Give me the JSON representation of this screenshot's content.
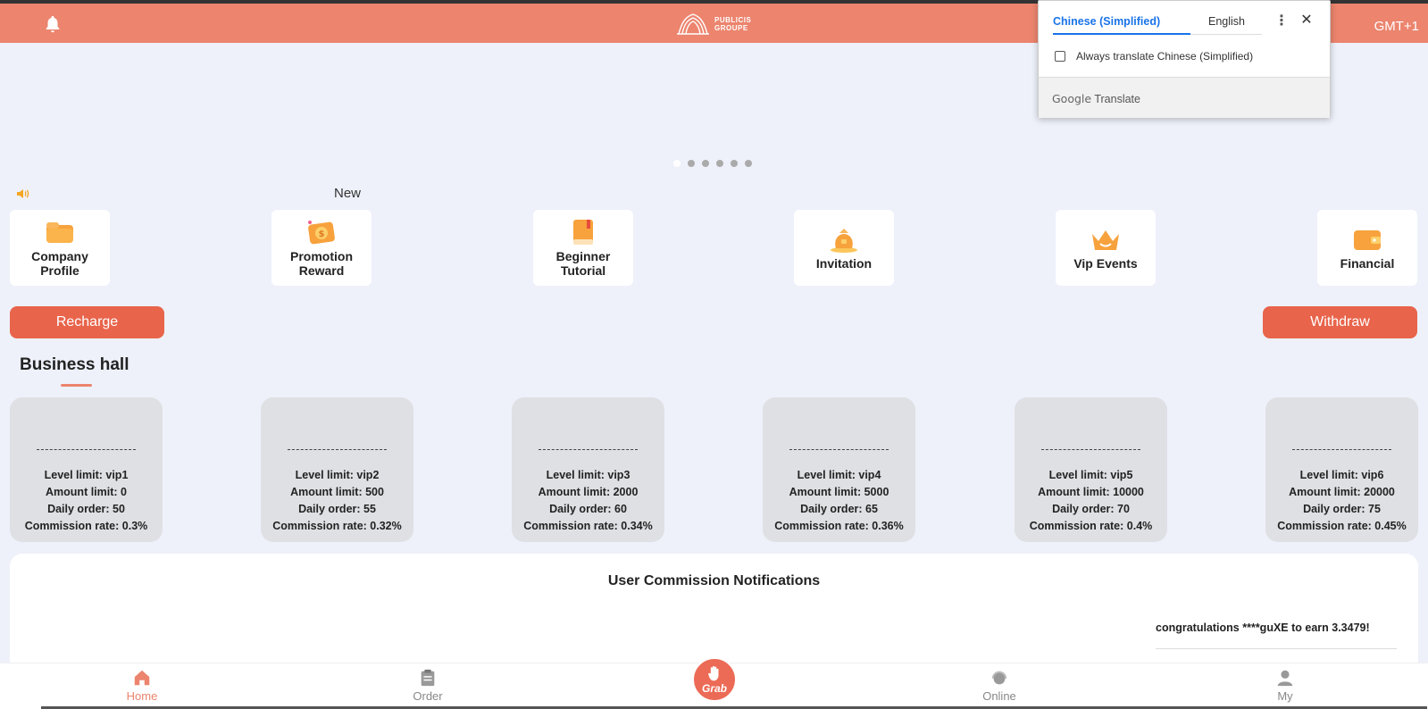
{
  "header": {
    "logo_line1": "PUBLICIS",
    "logo_line2": "GROUPE",
    "timezone": "GMT+1"
  },
  "announcement": {
    "text": "New"
  },
  "menu": [
    {
      "label_line1": "Company",
      "label_line2": "Profile",
      "icon": "folder-icon"
    },
    {
      "label_line1": "Promotion",
      "label_line2": "Reward",
      "icon": "money-envelope-icon"
    },
    {
      "label_line1": "Beginner",
      "label_line2": "Tutorial",
      "icon": "book-icon"
    },
    {
      "label_line1": "Invitation",
      "label_line2": "",
      "icon": "gift-bag-icon"
    },
    {
      "label_line1": "Vip Events",
      "label_line2": "",
      "icon": "crown-icon"
    },
    {
      "label_line1": "Financial",
      "label_line2": "",
      "icon": "wallet-icon"
    }
  ],
  "actions": {
    "recharge": "Recharge",
    "withdraw": "Withdraw"
  },
  "business_hall": {
    "title": "Business hall",
    "cards": [
      {
        "level": "Level limit: vip1",
        "amount": "Amount limit: 0",
        "daily": "Daily order: 50",
        "commission": "Commission rate: 0.3%"
      },
      {
        "level": "Level limit: vip2",
        "amount": "Amount limit: 500",
        "daily": "Daily order: 55",
        "commission": "Commission rate: 0.32%"
      },
      {
        "level": "Level limit: vip3",
        "amount": "Amount limit: 2000",
        "daily": "Daily order: 60",
        "commission": "Commission rate: 0.34%"
      },
      {
        "level": "Level limit: vip4",
        "amount": "Amount limit: 5000",
        "daily": "Daily order: 65",
        "commission": "Commission rate: 0.36%"
      },
      {
        "level": "Level limit: vip5",
        "amount": "Amount limit: 10000",
        "daily": "Daily order: 70",
        "commission": "Commission rate: 0.4%"
      },
      {
        "level": "Level limit: vip6",
        "amount": "Amount limit: 20000",
        "daily": "Daily order: 75",
        "commission": "Commission rate: 0.45%"
      }
    ]
  },
  "notifications": {
    "title": "User Commission Notifications",
    "message": "congratulations ****guXE to earn 3.3479!"
  },
  "tabbar": {
    "home": "Home",
    "order": "Order",
    "grab": "Grab",
    "online": "Online",
    "my": "My"
  },
  "translate_popup": {
    "tab_source": "Chinese (Simplified)",
    "tab_target": "English",
    "always_translate": "Always translate Chinese (Simplified)",
    "brand_google": "Google",
    "brand_translate": "Translate"
  },
  "colors": {
    "header": "#ec846e",
    "button": "#e8644b",
    "accent_blue": "#1a73e8"
  }
}
